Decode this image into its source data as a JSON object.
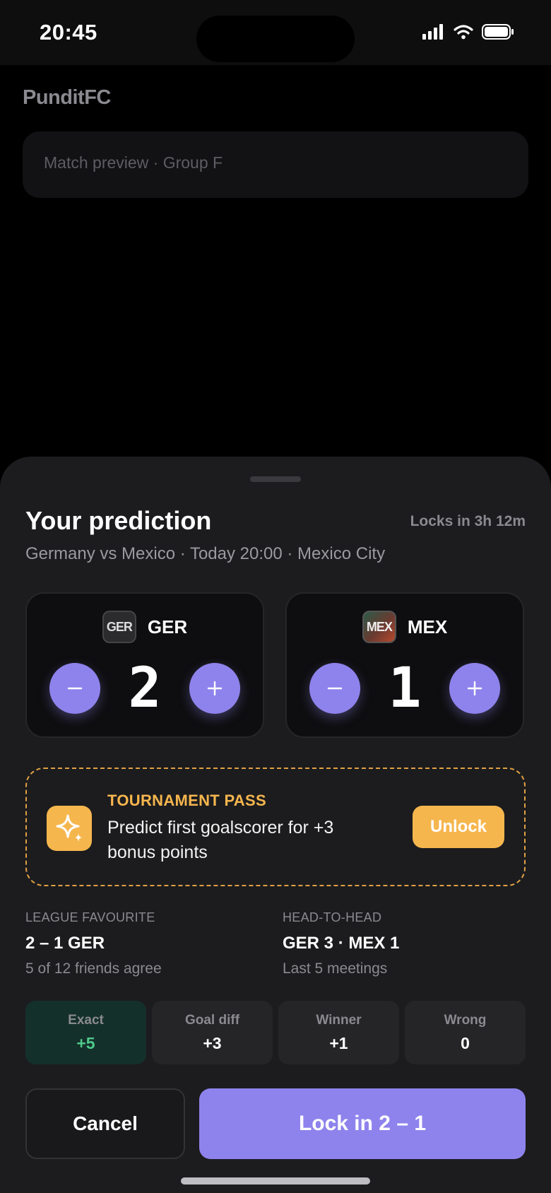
{
  "status": {
    "time": "20:45"
  },
  "app": {
    "brand": "PunditFC",
    "preview": "Match preview · Group F"
  },
  "sheet": {
    "title": "Your prediction",
    "locks": "Locks in 3h 12m",
    "subtitle": "Germany vs Mexico · Today 20:00 · Mexico City"
  },
  "teams": [
    {
      "flag": "GER",
      "code": "GER",
      "score": "2"
    },
    {
      "flag": "MEX",
      "code": "MEX",
      "score": "1"
    }
  ],
  "promo": {
    "kicker": "TOURNAMENT PASS",
    "text": "Predict first goalscorer for +3 bonus points",
    "button": "Unlock",
    "accent": "#f6b64e"
  },
  "stats": {
    "league": {
      "label": "LEAGUE FAVOURITE",
      "value": "2 – 1 GER",
      "sub": "5 of 12 friends agree"
    },
    "h2h": {
      "label": "HEAD-TO-HEAD",
      "value": "GER 3 · MEX 1",
      "sub": "Last 5 meetings"
    }
  },
  "points": [
    {
      "label": "Exact",
      "value": "+5"
    },
    {
      "label": "Goal diff",
      "value": "+3"
    },
    {
      "label": "Winner",
      "value": "+1"
    },
    {
      "label": "Wrong",
      "value": "0"
    }
  ],
  "actions": {
    "cancel": "Cancel",
    "lock": "Lock in 2 – 1"
  },
  "colors": {
    "primary": "#8e83ec",
    "positive": "#4ec98a"
  }
}
